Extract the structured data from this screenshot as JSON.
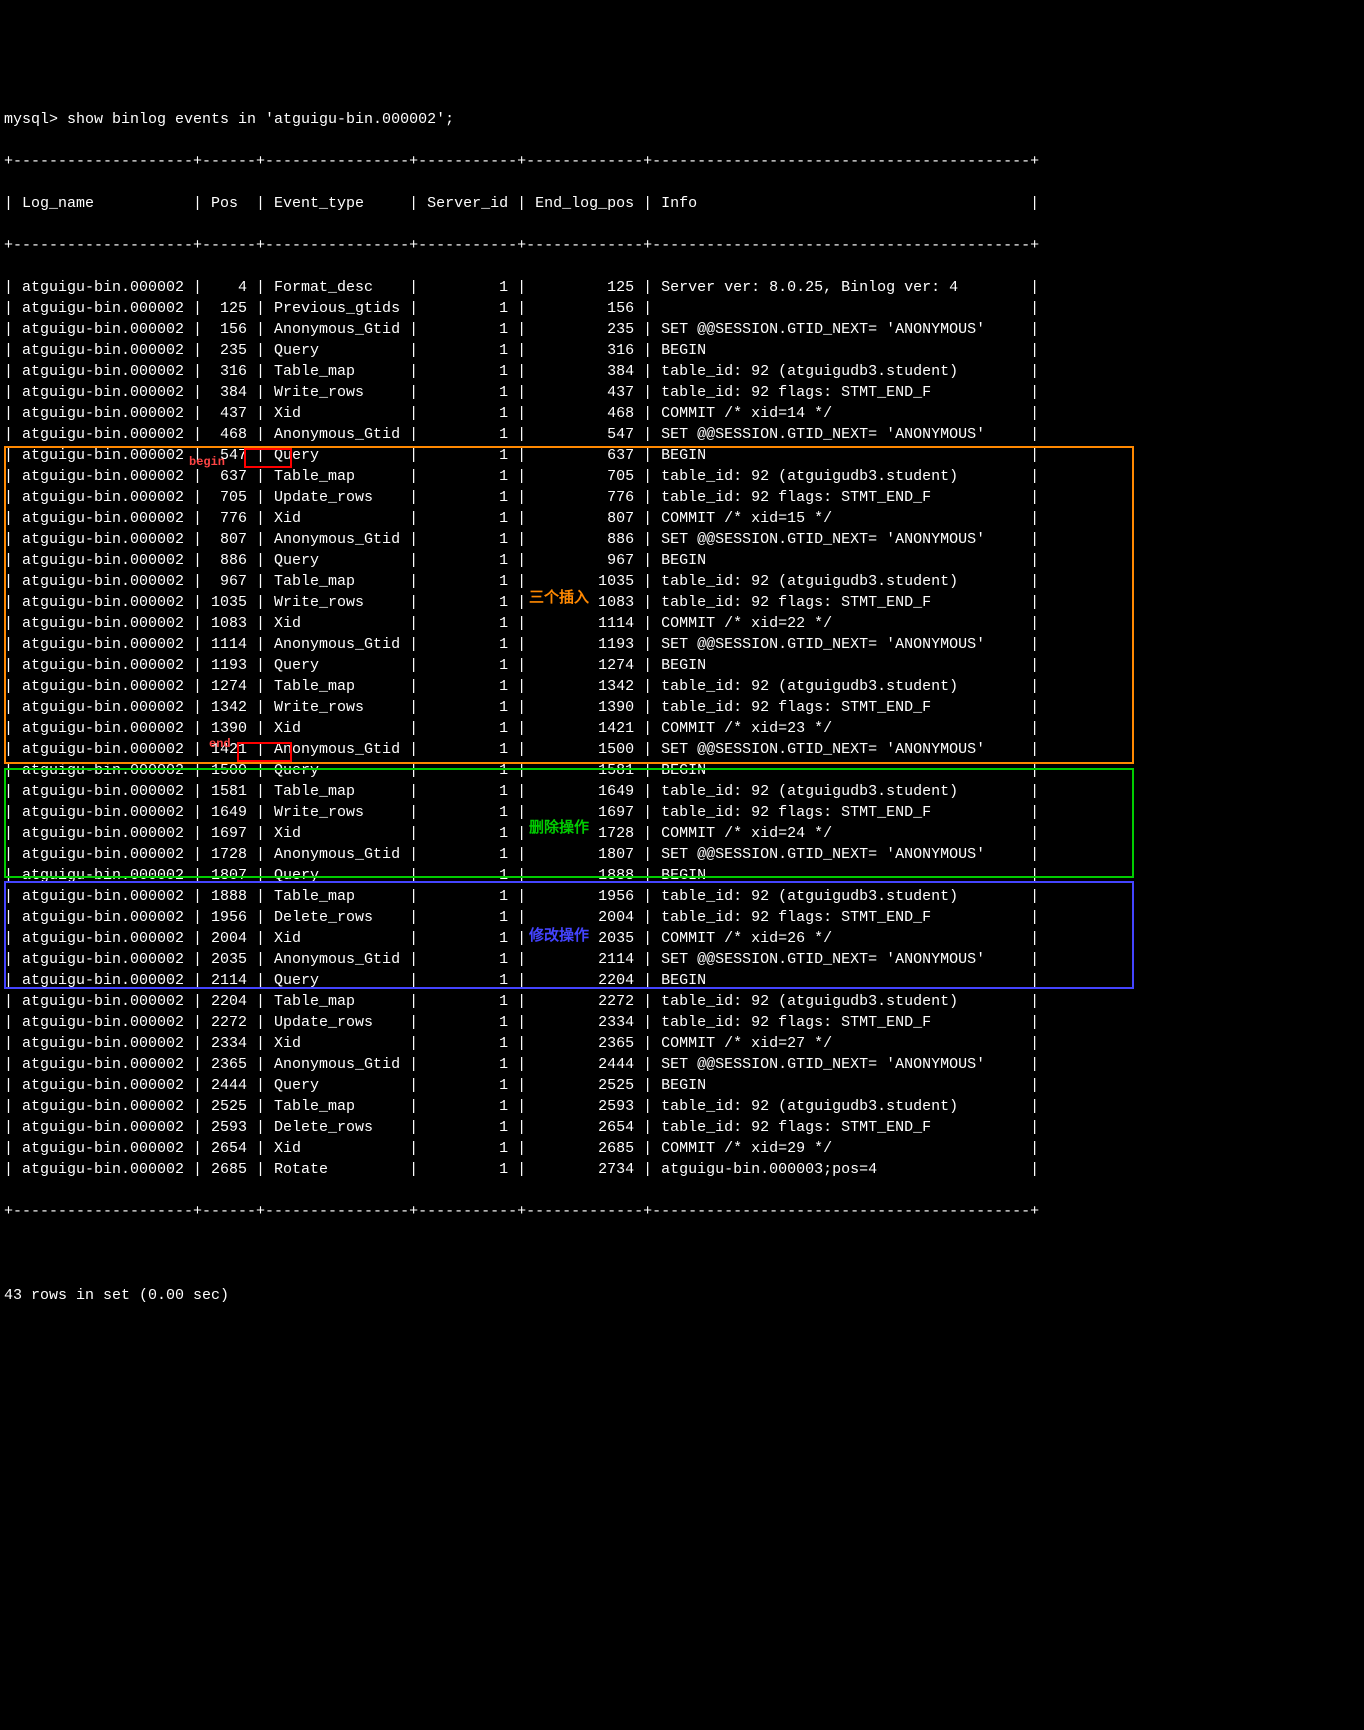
{
  "prompt": "mysql> show binlog events in 'atguigu-bin.000002';",
  "divider": "+--------------------+------+----------------+-----------+-------------+------------------------------------------+",
  "headers": {
    "log_name": "Log_name",
    "pos": "Pos",
    "event_type": "Event_type",
    "server_id": "Server_id",
    "end_log_pos": "End_log_pos",
    "info": "Info"
  },
  "rows": [
    {
      "log_name": "atguigu-bin.000002",
      "pos": "4",
      "event_type": "Format_desc",
      "server_id": "1",
      "end_log_pos": "125",
      "info": "Server ver: 8.0.25, Binlog ver: 4"
    },
    {
      "log_name": "atguigu-bin.000002",
      "pos": "125",
      "event_type": "Previous_gtids",
      "server_id": "1",
      "end_log_pos": "156",
      "info": ""
    },
    {
      "log_name": "atguigu-bin.000002",
      "pos": "156",
      "event_type": "Anonymous_Gtid",
      "server_id": "1",
      "end_log_pos": "235",
      "info": "SET @@SESSION.GTID_NEXT= 'ANONYMOUS'"
    },
    {
      "log_name": "atguigu-bin.000002",
      "pos": "235",
      "event_type": "Query",
      "server_id": "1",
      "end_log_pos": "316",
      "info": "BEGIN"
    },
    {
      "log_name": "atguigu-bin.000002",
      "pos": "316",
      "event_type": "Table_map",
      "server_id": "1",
      "end_log_pos": "384",
      "info": "table_id: 92 (atguigudb3.student)"
    },
    {
      "log_name": "atguigu-bin.000002",
      "pos": "384",
      "event_type": "Write_rows",
      "server_id": "1",
      "end_log_pos": "437",
      "info": "table_id: 92 flags: STMT_END_F"
    },
    {
      "log_name": "atguigu-bin.000002",
      "pos": "437",
      "event_type": "Xid",
      "server_id": "1",
      "end_log_pos": "468",
      "info": "COMMIT /* xid=14 */"
    },
    {
      "log_name": "atguigu-bin.000002",
      "pos": "468",
      "event_type": "Anonymous_Gtid",
      "server_id": "1",
      "end_log_pos": "547",
      "info": "SET @@SESSION.GTID_NEXT= 'ANONYMOUS'"
    },
    {
      "log_name": "atguigu-bin.000002",
      "pos": "547",
      "event_type": "Query",
      "server_id": "1",
      "end_log_pos": "637",
      "info": "BEGIN"
    },
    {
      "log_name": "atguigu-bin.000002",
      "pos": "637",
      "event_type": "Table_map",
      "server_id": "1",
      "end_log_pos": "705",
      "info": "table_id: 92 (atguigudb3.student)"
    },
    {
      "log_name": "atguigu-bin.000002",
      "pos": "705",
      "event_type": "Update_rows",
      "server_id": "1",
      "end_log_pos": "776",
      "info": "table_id: 92 flags: STMT_END_F"
    },
    {
      "log_name": "atguigu-bin.000002",
      "pos": "776",
      "event_type": "Xid",
      "server_id": "1",
      "end_log_pos": "807",
      "info": "COMMIT /* xid=15 */"
    },
    {
      "log_name": "atguigu-bin.000002",
      "pos": "807",
      "event_type": "Anonymous_Gtid",
      "server_id": "1",
      "end_log_pos": "886",
      "info": "SET @@SESSION.GTID_NEXT= 'ANONYMOUS'"
    },
    {
      "log_name": "atguigu-bin.000002",
      "pos": "886",
      "event_type": "Query",
      "server_id": "1",
      "end_log_pos": "967",
      "info": "BEGIN"
    },
    {
      "log_name": "atguigu-bin.000002",
      "pos": "967",
      "event_type": "Table_map",
      "server_id": "1",
      "end_log_pos": "1035",
      "info": "table_id: 92 (atguigudb3.student)"
    },
    {
      "log_name": "atguigu-bin.000002",
      "pos": "1035",
      "event_type": "Write_rows",
      "server_id": "1",
      "end_log_pos": "1083",
      "info": "table_id: 92 flags: STMT_END_F"
    },
    {
      "log_name": "atguigu-bin.000002",
      "pos": "1083",
      "event_type": "Xid",
      "server_id": "1",
      "end_log_pos": "1114",
      "info": "COMMIT /* xid=22 */"
    },
    {
      "log_name": "atguigu-bin.000002",
      "pos": "1114",
      "event_type": "Anonymous_Gtid",
      "server_id": "1",
      "end_log_pos": "1193",
      "info": "SET @@SESSION.GTID_NEXT= 'ANONYMOUS'"
    },
    {
      "log_name": "atguigu-bin.000002",
      "pos": "1193",
      "event_type": "Query",
      "server_id": "1",
      "end_log_pos": "1274",
      "info": "BEGIN"
    },
    {
      "log_name": "atguigu-bin.000002",
      "pos": "1274",
      "event_type": "Table_map",
      "server_id": "1",
      "end_log_pos": "1342",
      "info": "table_id: 92 (atguigudb3.student)"
    },
    {
      "log_name": "atguigu-bin.000002",
      "pos": "1342",
      "event_type": "Write_rows",
      "server_id": "1",
      "end_log_pos": "1390",
      "info": "table_id: 92 flags: STMT_END_F"
    },
    {
      "log_name": "atguigu-bin.000002",
      "pos": "1390",
      "event_type": "Xid",
      "server_id": "1",
      "end_log_pos": "1421",
      "info": "COMMIT /* xid=23 */"
    },
    {
      "log_name": "atguigu-bin.000002",
      "pos": "1421",
      "event_type": "Anonymous_Gtid",
      "server_id": "1",
      "end_log_pos": "1500",
      "info": "SET @@SESSION.GTID_NEXT= 'ANONYMOUS'"
    },
    {
      "log_name": "atguigu-bin.000002",
      "pos": "1500",
      "event_type": "Query",
      "server_id": "1",
      "end_log_pos": "1581",
      "info": "BEGIN"
    },
    {
      "log_name": "atguigu-bin.000002",
      "pos": "1581",
      "event_type": "Table_map",
      "server_id": "1",
      "end_log_pos": "1649",
      "info": "table_id: 92 (atguigudb3.student)"
    },
    {
      "log_name": "atguigu-bin.000002",
      "pos": "1649",
      "event_type": "Write_rows",
      "server_id": "1",
      "end_log_pos": "1697",
      "info": "table_id: 92 flags: STMT_END_F"
    },
    {
      "log_name": "atguigu-bin.000002",
      "pos": "1697",
      "event_type": "Xid",
      "server_id": "1",
      "end_log_pos": "1728",
      "info": "COMMIT /* xid=24 */"
    },
    {
      "log_name": "atguigu-bin.000002",
      "pos": "1728",
      "event_type": "Anonymous_Gtid",
      "server_id": "1",
      "end_log_pos": "1807",
      "info": "SET @@SESSION.GTID_NEXT= 'ANONYMOUS'"
    },
    {
      "log_name": "atguigu-bin.000002",
      "pos": "1807",
      "event_type": "Query",
      "server_id": "1",
      "end_log_pos": "1888",
      "info": "BEGIN"
    },
    {
      "log_name": "atguigu-bin.000002",
      "pos": "1888",
      "event_type": "Table_map",
      "server_id": "1",
      "end_log_pos": "1956",
      "info": "table_id: 92 (atguigudb3.student)"
    },
    {
      "log_name": "atguigu-bin.000002",
      "pos": "1956",
      "event_type": "Delete_rows",
      "server_id": "1",
      "end_log_pos": "2004",
      "info": "table_id: 92 flags: STMT_END_F"
    },
    {
      "log_name": "atguigu-bin.000002",
      "pos": "2004",
      "event_type": "Xid",
      "server_id": "1",
      "end_log_pos": "2035",
      "info": "COMMIT /* xid=26 */"
    },
    {
      "log_name": "atguigu-bin.000002",
      "pos": "2035",
      "event_type": "Anonymous_Gtid",
      "server_id": "1",
      "end_log_pos": "2114",
      "info": "SET @@SESSION.GTID_NEXT= 'ANONYMOUS'"
    },
    {
      "log_name": "atguigu-bin.000002",
      "pos": "2114",
      "event_type": "Query",
      "server_id": "1",
      "end_log_pos": "2204",
      "info": "BEGIN"
    },
    {
      "log_name": "atguigu-bin.000002",
      "pos": "2204",
      "event_type": "Table_map",
      "server_id": "1",
      "end_log_pos": "2272",
      "info": "table_id: 92 (atguigudb3.student)"
    },
    {
      "log_name": "atguigu-bin.000002",
      "pos": "2272",
      "event_type": "Update_rows",
      "server_id": "1",
      "end_log_pos": "2334",
      "info": "table_id: 92 flags: STMT_END_F"
    },
    {
      "log_name": "atguigu-bin.000002",
      "pos": "2334",
      "event_type": "Xid",
      "server_id": "1",
      "end_log_pos": "2365",
      "info": "COMMIT /* xid=27 */"
    },
    {
      "log_name": "atguigu-bin.000002",
      "pos": "2365",
      "event_type": "Anonymous_Gtid",
      "server_id": "1",
      "end_log_pos": "2444",
      "info": "SET @@SESSION.GTID_NEXT= 'ANONYMOUS'"
    },
    {
      "log_name": "atguigu-bin.000002",
      "pos": "2444",
      "event_type": "Query",
      "server_id": "1",
      "end_log_pos": "2525",
      "info": "BEGIN"
    },
    {
      "log_name": "atguigu-bin.000002",
      "pos": "2525",
      "event_type": "Table_map",
      "server_id": "1",
      "end_log_pos": "2593",
      "info": "table_id: 92 (atguigudb3.student)"
    },
    {
      "log_name": "atguigu-bin.000002",
      "pos": "2593",
      "event_type": "Delete_rows",
      "server_id": "1",
      "end_log_pos": "2654",
      "info": "table_id: 92 flags: STMT_END_F"
    },
    {
      "log_name": "atguigu-bin.000002",
      "pos": "2654",
      "event_type": "Xid",
      "server_id": "1",
      "end_log_pos": "2685",
      "info": "COMMIT /* xid=29 */"
    },
    {
      "log_name": "atguigu-bin.000002",
      "pos": "2685",
      "event_type": "Rotate",
      "server_id": "1",
      "end_log_pos": "2734",
      "info": "atguigu-bin.000003;pos=4"
    }
  ],
  "footer": "43 rows in set (0.00 sec)",
  "annotations": {
    "begin_label": "begin",
    "end_label": "end",
    "insert_label": "三个插入",
    "delete_label": "删除操作",
    "update_label": "修改操作"
  }
}
